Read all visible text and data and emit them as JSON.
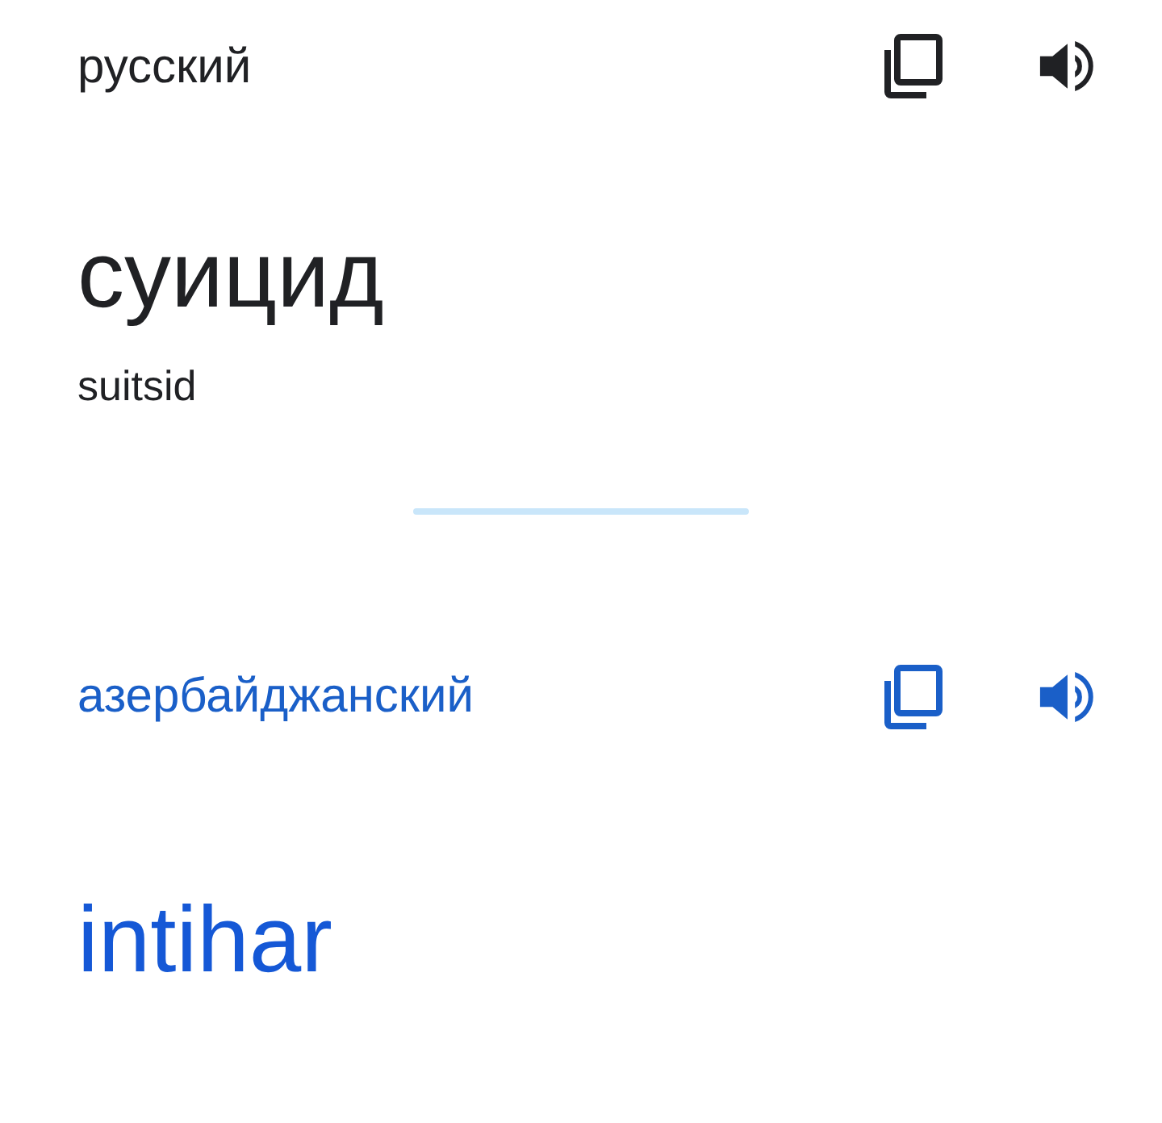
{
  "source": {
    "language": "русский",
    "text": "суицид",
    "transliteration": "suitsid"
  },
  "target": {
    "language": "азербайджанский",
    "text": "intihar"
  }
}
